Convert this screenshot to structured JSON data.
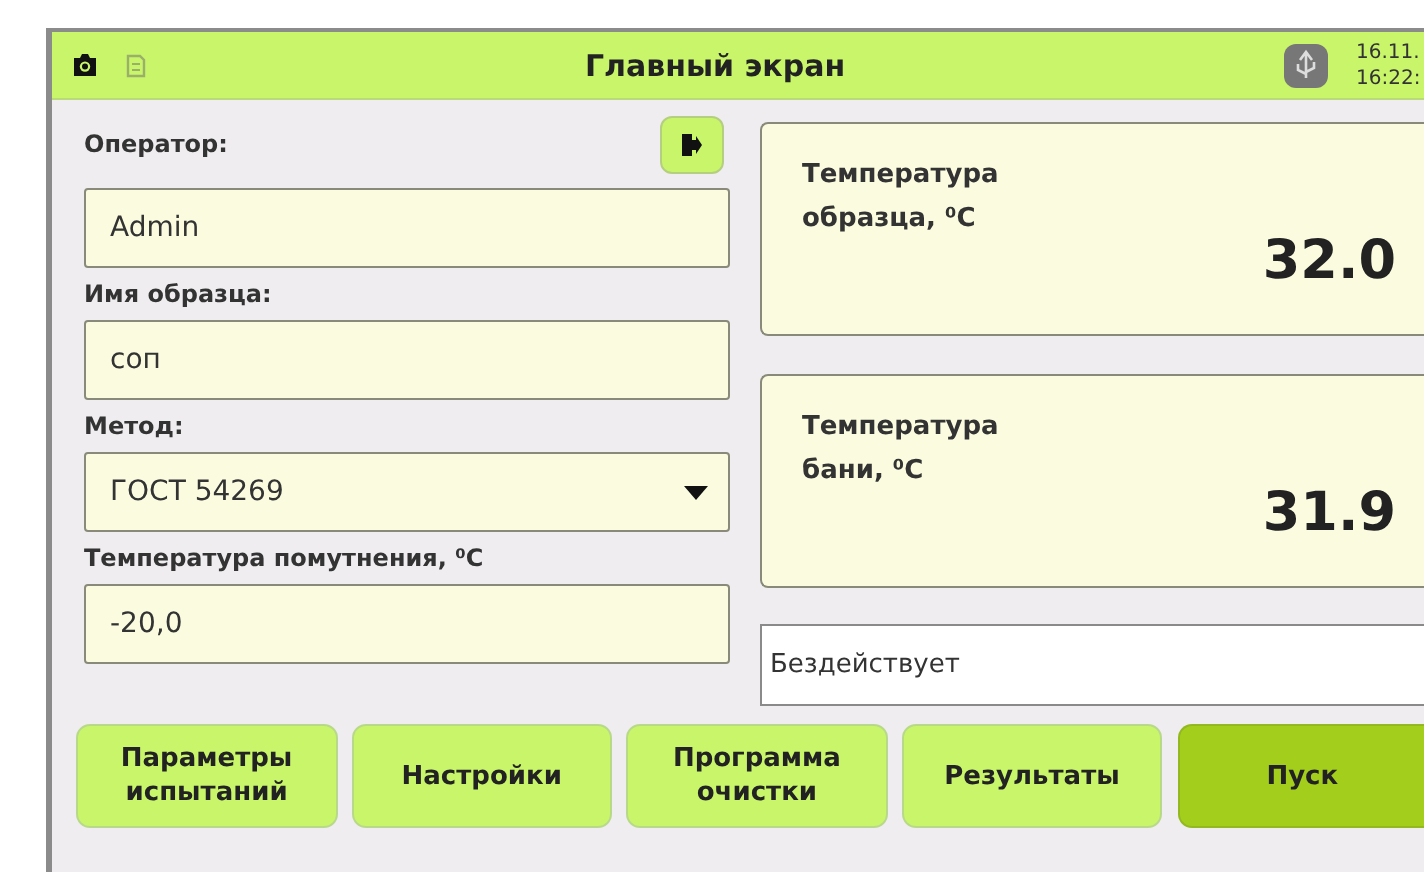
{
  "header": {
    "title": "Главный экран",
    "date": "16.11.",
    "time": "16:22:"
  },
  "fields": [
    {
      "label": "Оператор:",
      "kind": "text",
      "value": "Admin"
    },
    {
      "label": "Имя образца:",
      "kind": "text",
      "value": "соп"
    },
    {
      "label": "Метод:",
      "kind": "select",
      "value": "ГОСТ 54269"
    },
    {
      "label": "Температура помутнения, ⁰С",
      "kind": "text",
      "value": "-20,0"
    }
  ],
  "readings": [
    {
      "label": "Температура образца, ⁰С",
      "value": "32.0"
    },
    {
      "label": "Температура бани, ⁰С",
      "value": "31.9"
    }
  ],
  "status": "Бездействует",
  "buttons": [
    {
      "label": "Параметры испытаний",
      "kind": "normal"
    },
    {
      "label": "Настройки",
      "kind": "normal"
    },
    {
      "label": "Программа очистки",
      "kind": "normal"
    },
    {
      "label": "Результаты",
      "kind": "normal"
    },
    {
      "label": "Пуск",
      "kind": "primary"
    }
  ]
}
